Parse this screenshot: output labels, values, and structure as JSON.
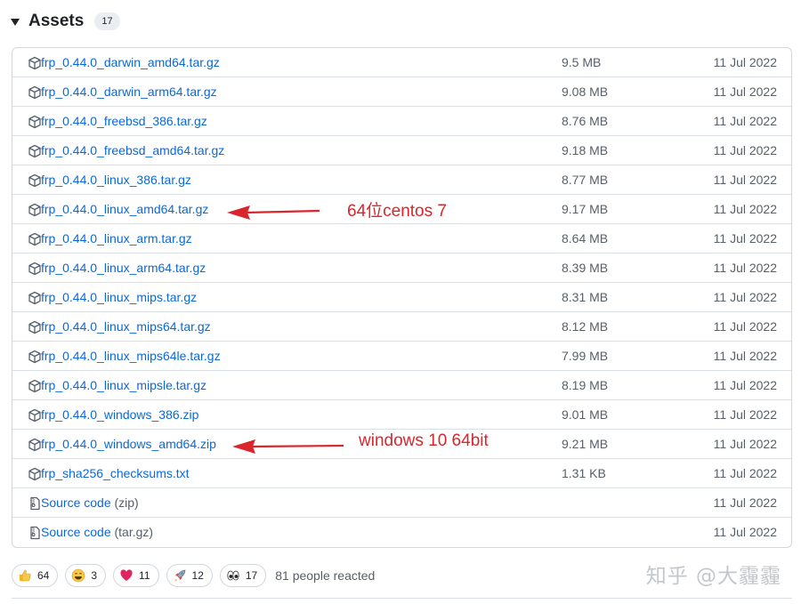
{
  "header": {
    "title": "Assets",
    "count": "17"
  },
  "assets": [
    {
      "name": "frp_0.44.0_darwin_amd64.tar.gz",
      "suffix": "",
      "size": "9.5 MB",
      "date": "11 Jul 2022",
      "icon": "package-icon"
    },
    {
      "name": "frp_0.44.0_darwin_arm64.tar.gz",
      "suffix": "",
      "size": "9.08 MB",
      "date": "11 Jul 2022",
      "icon": "package-icon"
    },
    {
      "name": "frp_0.44.0_freebsd_386.tar.gz",
      "suffix": "",
      "size": "8.76 MB",
      "date": "11 Jul 2022",
      "icon": "package-icon"
    },
    {
      "name": "frp_0.44.0_freebsd_amd64.tar.gz",
      "suffix": "",
      "size": "9.18 MB",
      "date": "11 Jul 2022",
      "icon": "package-icon"
    },
    {
      "name": "frp_0.44.0_linux_386.tar.gz",
      "suffix": "",
      "size": "8.77 MB",
      "date": "11 Jul 2022",
      "icon": "package-icon"
    },
    {
      "name": "frp_0.44.0_linux_amd64.tar.gz",
      "suffix": "",
      "size": "9.17 MB",
      "date": "11 Jul 2022",
      "icon": "package-icon"
    },
    {
      "name": "frp_0.44.0_linux_arm.tar.gz",
      "suffix": "",
      "size": "8.64 MB",
      "date": "11 Jul 2022",
      "icon": "package-icon"
    },
    {
      "name": "frp_0.44.0_linux_arm64.tar.gz",
      "suffix": "",
      "size": "8.39 MB",
      "date": "11 Jul 2022",
      "icon": "package-icon"
    },
    {
      "name": "frp_0.44.0_linux_mips.tar.gz",
      "suffix": "",
      "size": "8.31 MB",
      "date": "11 Jul 2022",
      "icon": "package-icon"
    },
    {
      "name": "frp_0.44.0_linux_mips64.tar.gz",
      "suffix": "",
      "size": "8.12 MB",
      "date": "11 Jul 2022",
      "icon": "package-icon"
    },
    {
      "name": "frp_0.44.0_linux_mips64le.tar.gz",
      "suffix": "",
      "size": "7.99 MB",
      "date": "11 Jul 2022",
      "icon": "package-icon"
    },
    {
      "name": "frp_0.44.0_linux_mipsle.tar.gz",
      "suffix": "",
      "size": "8.19 MB",
      "date": "11 Jul 2022",
      "icon": "package-icon"
    },
    {
      "name": "frp_0.44.0_windows_386.zip",
      "suffix": "",
      "size": "9.01 MB",
      "date": "11 Jul 2022",
      "icon": "package-icon"
    },
    {
      "name": "frp_0.44.0_windows_amd64.zip",
      "suffix": "",
      "size": "9.21 MB",
      "date": "11 Jul 2022",
      "icon": "package-icon"
    },
    {
      "name": "frp_sha256_checksums.txt",
      "suffix": "",
      "size": "1.31 KB",
      "date": "11 Jul 2022",
      "icon": "package-icon"
    },
    {
      "name": "Source code",
      "suffix": " (zip)",
      "size": "",
      "date": "11 Jul 2022",
      "icon": "file-zip-icon"
    },
    {
      "name": "Source code",
      "suffix": " (tar.gz)",
      "size": "",
      "date": "11 Jul 2022",
      "icon": "file-zip-icon"
    }
  ],
  "annotations": [
    {
      "text": "64位centos 7",
      "target": "frp_0.44.0_linux_amd64.tar.gz",
      "color": "#d9262c"
    },
    {
      "text": "windows 10 64bit",
      "target": "frp_0.44.0_windows_amd64.zip",
      "color": "#d9262c"
    }
  ],
  "reactions": [
    {
      "icon": "thumbs-up-icon",
      "count": "64"
    },
    {
      "icon": "smile-icon",
      "count": "3"
    },
    {
      "icon": "heart-icon",
      "count": "11"
    },
    {
      "icon": "rocket-icon",
      "count": "12"
    },
    {
      "icon": "eyes-icon",
      "count": "17"
    }
  ],
  "reacted_text": "81 people reacted",
  "watermark": "知乎 @大霾霾",
  "colors": {
    "link": "#0969da",
    "muted": "#57606a",
    "border": "#d0d7de",
    "annotation": "#d9262c"
  }
}
